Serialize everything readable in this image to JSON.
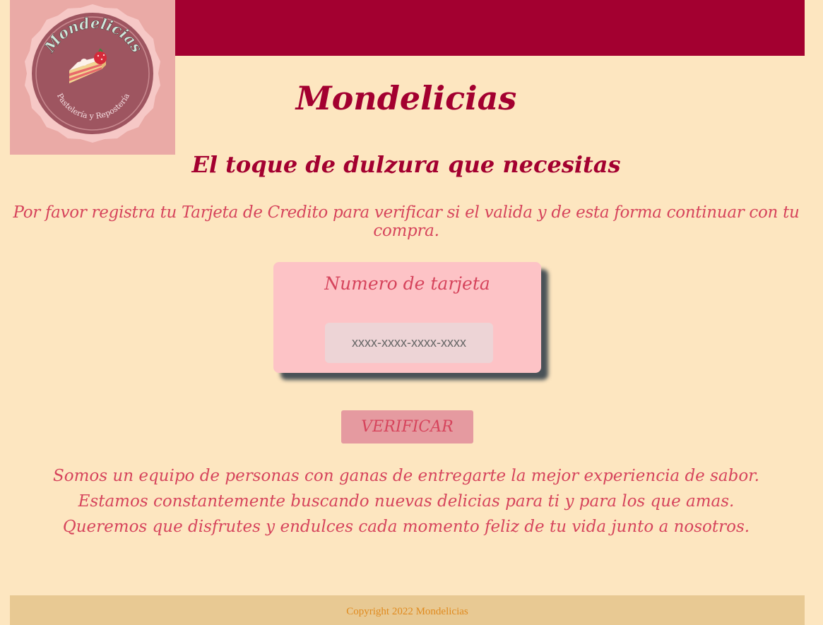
{
  "header": {
    "logo": {
      "icon": "cake-logo-icon",
      "wordmark": "Mondelicias",
      "subtext": "Pastelería y Repostería"
    }
  },
  "hero": {
    "title": "Mondelicias",
    "tagline": "El toque de dulzura que necesitas",
    "instructions": "Por favor registra tu Tarjeta de Credito para verificar si el valida y de esta forma continuar con tu compra."
  },
  "card_form": {
    "label": "Numero de tarjeta",
    "input_value": "",
    "input_placeholder": "xxxx-xxxx-xxxx-xxxx"
  },
  "actions": {
    "verify_label": "VERIFICAR"
  },
  "about": {
    "lines": [
      "Somos un equipo de personas con ganas de entregarte la mejor experiencia de sabor.",
      "Estamos constantemente buscando nuevas delicias para ti y para los que amas.",
      "Queremos que disfrutes y endulces cada momento feliz de tu vida junto a nosotros."
    ]
  },
  "footer": {
    "copyright": "Copyright 2022 Mondelicias"
  },
  "colors": {
    "background": "#fde6c0",
    "header_bar": "#a30030",
    "accent_text": "#d6445c",
    "card_bg": "#fdc3c6",
    "button_bg": "#e59aa0",
    "footer_bg": "#e8c993",
    "footer_text": "#e08a1e"
  }
}
